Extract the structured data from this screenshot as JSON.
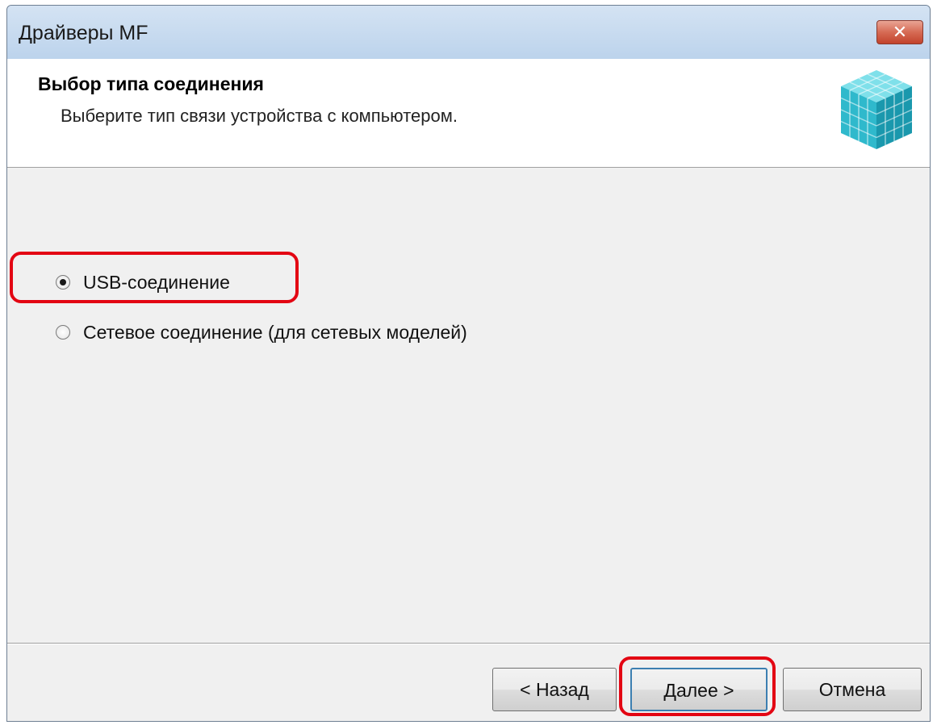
{
  "window": {
    "title": "Драйверы MF",
    "close_glyph": "✕"
  },
  "header": {
    "title": "Выбор типа соединения",
    "subtitle": "Выберите тип связи устройства с компьютером.",
    "icon": "cube-icon"
  },
  "options": [
    {
      "label": "USB-соединение",
      "checked": true
    },
    {
      "label": "Сетевое соединение (для сетевых моделей)",
      "checked": false
    }
  ],
  "buttons": {
    "back": "< Назад",
    "next": "Далее >",
    "cancel": "Отмена"
  },
  "colors": {
    "highlight": "#e30613",
    "cube": "#33c6d6"
  }
}
